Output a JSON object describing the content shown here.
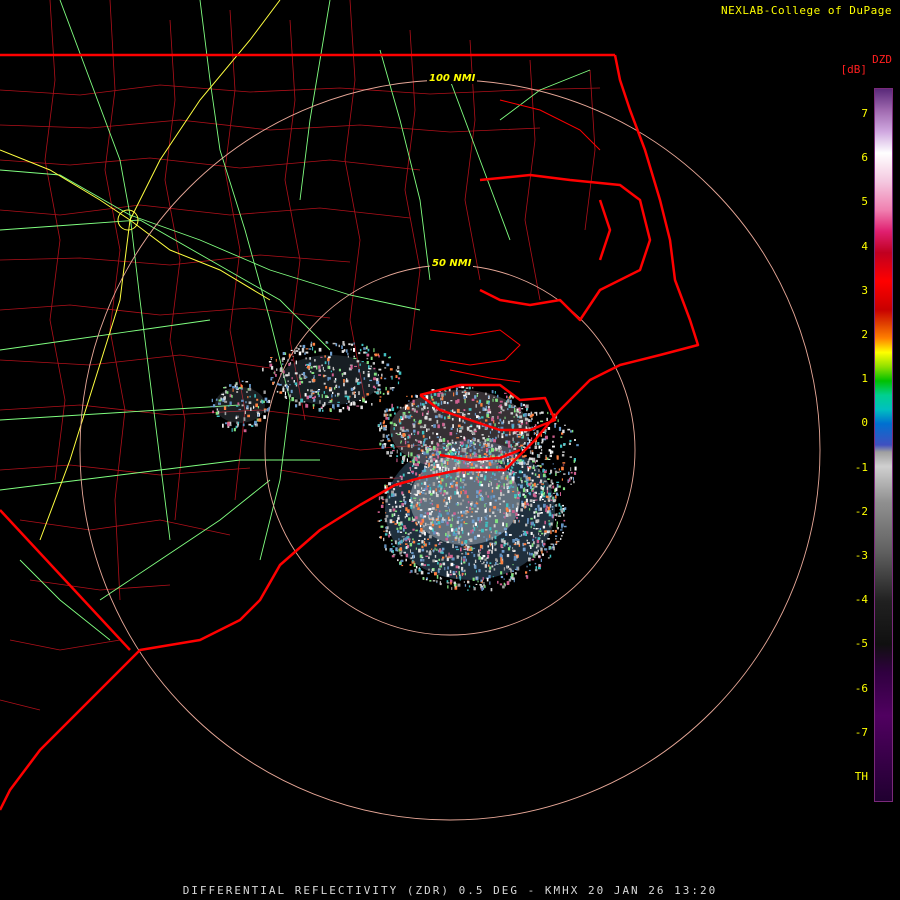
{
  "header": {
    "credit": "NEXLAB-College of DuPage"
  },
  "legend": {
    "title": "DZD",
    "units": "[dB]",
    "ticks": [
      "7",
      "6",
      "5",
      "4",
      "3",
      "2",
      "1",
      "0",
      "-1",
      "-2",
      "-3",
      "-4",
      "-5",
      "-6",
      "-7",
      "TH"
    ]
  },
  "rings": {
    "inner": "50 NMI",
    "outer": "100 NMI"
  },
  "footer": {
    "product": "DIFFERENTIAL REFLECTIVITY (ZDR) 0.5 DEG - KMHX 20 JAN 26 13:20"
  },
  "colors": {
    "state_lines": "#ff0000",
    "county_lines": "#c0101a",
    "highways": "#80ff80",
    "interstates": "#ffff40",
    "range_rings": "#e8a898",
    "text": "#ffff00"
  }
}
